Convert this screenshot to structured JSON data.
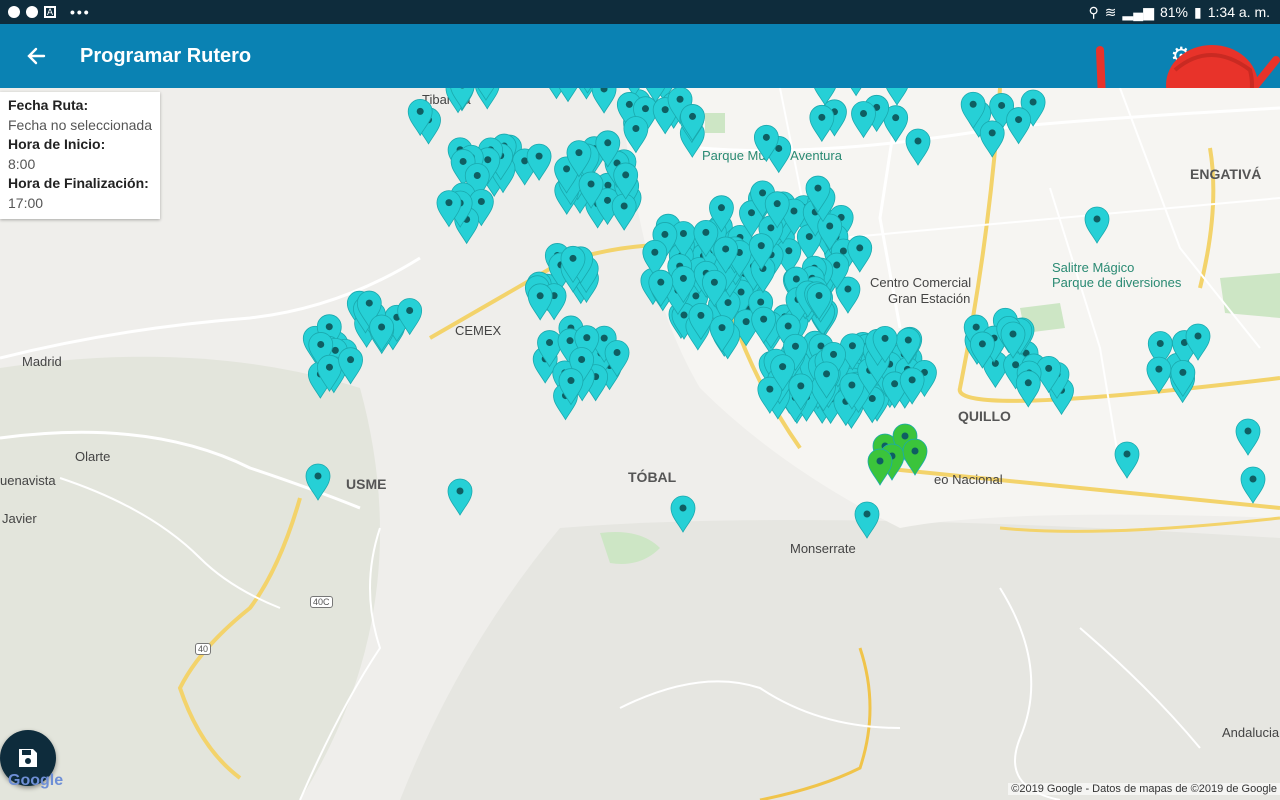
{
  "status_bar": {
    "battery": "81%",
    "time": "1:34 a. m."
  },
  "app_bar": {
    "title": "Programar Rutero"
  },
  "route_info": {
    "fecha_label": "Fecha Ruta:",
    "fecha_value": "Fecha no seleccionada",
    "inicio_label": "Hora de Inicio:",
    "inicio_value": "8:00",
    "fin_label": "Hora de Finalización:",
    "fin_value": "17:00"
  },
  "map_labels": {
    "tibanica": "Tibanica",
    "parque_mundo_aventura": "Parque Mundo Aventura",
    "engativa": "ENGATIVÁ",
    "centro_comercial": "Centro Comercial",
    "gran_estacion": "Gran Estación",
    "salitre_magico": "Salitre Mágico",
    "parque_diversiones": "Parque de diversiones",
    "cemex": "CEMEX",
    "madrid": "Madrid",
    "olarte": "Olarte",
    "usme": "USME",
    "buenavista": "uenavista",
    "javier": "Javier",
    "san_cristobal": "TÓBAL",
    "quillo": "QUILLO",
    "nacional": "eo Nacional",
    "monserrate": "Monserrate",
    "andalucia": "Andalucia",
    "route_40": "40",
    "route_40c": "40C",
    "google": "Google",
    "attribution": "©2019 Google - Datos de mapas de ©2019 de Google"
  },
  "colors": {
    "app_bar": "#0a82b3",
    "status_bar": "#0e2c3c",
    "marker": "#26d0d6",
    "marker_selected": "#3bc43b"
  }
}
